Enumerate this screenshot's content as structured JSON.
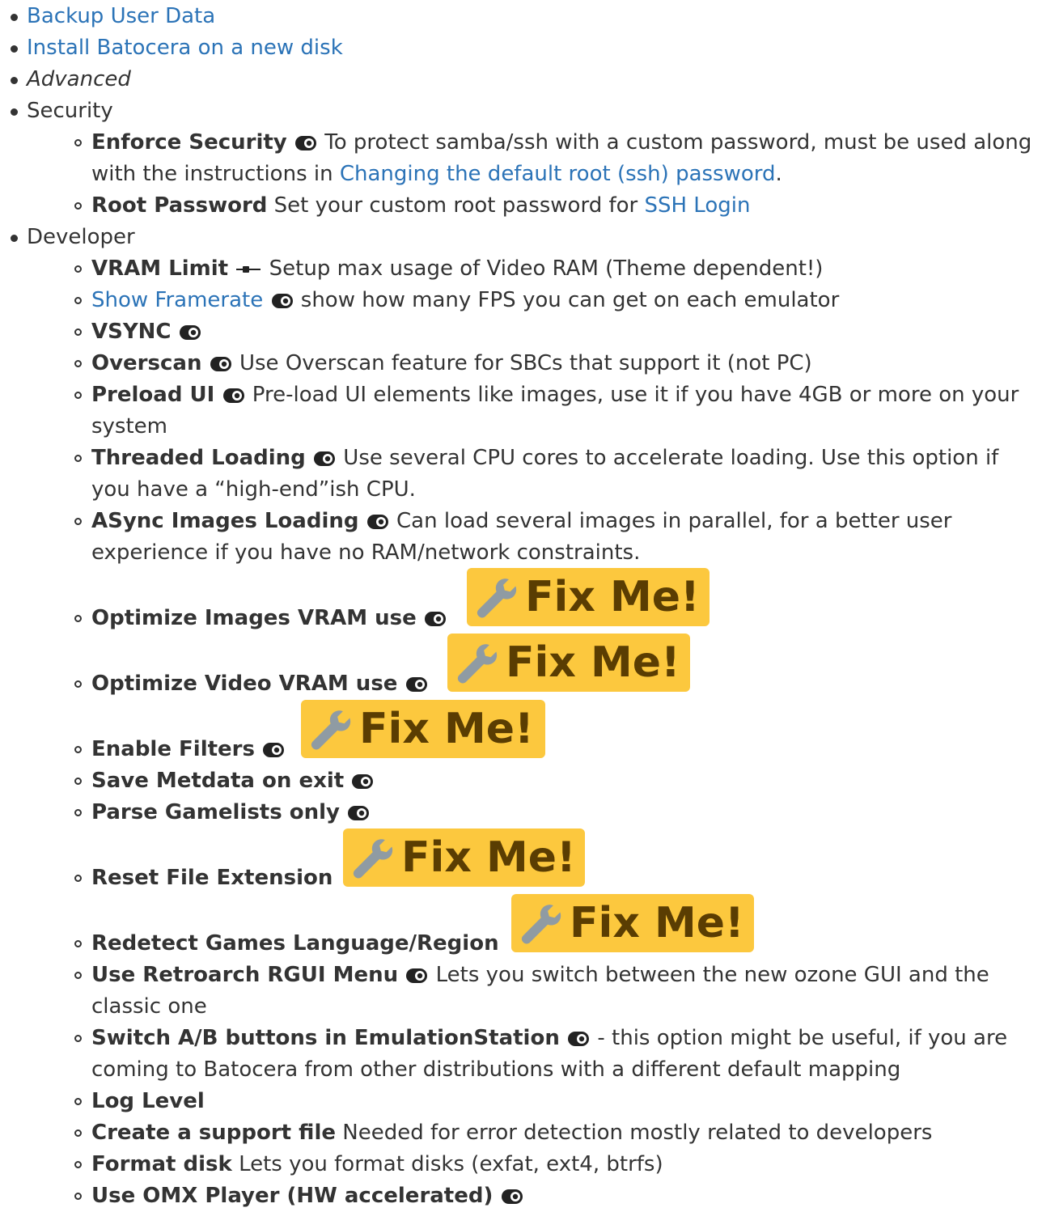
{
  "items": {
    "backup": "Backup User Data",
    "install": "Install Batocera on a new disk",
    "advanced": "Advanced",
    "security": "Security",
    "developer": "Developer"
  },
  "security": {
    "enforce_title": "Enforce Security",
    "enforce_desc": " To protect samba/ssh with a custom password, must be used along",
    "enforce_desc2": "with the instructions in ",
    "enforce_link": "Changing the default root (ssh) password",
    "enforce_tail": ".",
    "root_title": "Root Password",
    "root_desc": " Set your custom root password for ",
    "root_link": "SSH Login"
  },
  "developer": {
    "vram_title": "VRAM Limit",
    "vram_desc": " Setup max usage of Video RAM (Theme dependent!)",
    "framerate_link": "Show Framerate",
    "framerate_desc": " show how many FPS you can get on each emulator",
    "vsync_title": "VSYNC",
    "overscan_title": "Overscan",
    "overscan_desc": " Use Overscan feature for SBCs that support it (not PC)",
    "preload_title": "Preload UI",
    "preload_desc": " Pre-load UI elements like images, use it if you have 4GB or more on your",
    "preload_desc2": "system",
    "threaded_title": "Threaded Loading",
    "threaded_desc": " Use several CPU cores to accelerate loading. Use this option if",
    "threaded_desc2": "you have a “high-end”ish CPU.",
    "async_title": "ASync Images Loading",
    "async_desc": " Can load several images in parallel, for a better user",
    "async_desc2": "experience if you have no RAM/network constraints.",
    "opt_images_title": "Optimize Images VRAM use",
    "opt_video_title": "Optimize Video VRAM use",
    "filters_title": "Enable Filters",
    "save_meta_title": "Save Metdata on exit",
    "parse_title": "Parse Gamelists only",
    "reset_ext_title": "Reset File Extension",
    "redetect_title": "Redetect Games Language/Region",
    "rgui_title": "Use Retroarch RGUI Menu",
    "rgui_desc": " Lets you switch between the new ozone GUI and the",
    "rgui_desc2": "classic one",
    "switchab_title": "Switch A/B buttons in EmulationStation",
    "switchab_desc": " - this option might be useful, if you are",
    "switchab_desc2": "coming to Batocera from other distributions with a different default mapping",
    "loglevel_title": "Log Level",
    "support_title": "Create a support file",
    "support_desc": " Needed for error detection mostly related to developers",
    "format_title": "Format disk",
    "format_desc": " Lets you format disks (exfat, ext4, btrfs)",
    "omx_title": "Use OMX Player (HW accelerated)"
  },
  "fixme_label": "Fix Me!",
  "icons": {
    "toggle": "toggle-icon",
    "slider": "slider-icon",
    "wrench": "wrench-icon"
  },
  "colors": {
    "link": "#2b73b7",
    "fixme_bg": "#fcc83e",
    "fixme_text": "#5a3d02"
  }
}
